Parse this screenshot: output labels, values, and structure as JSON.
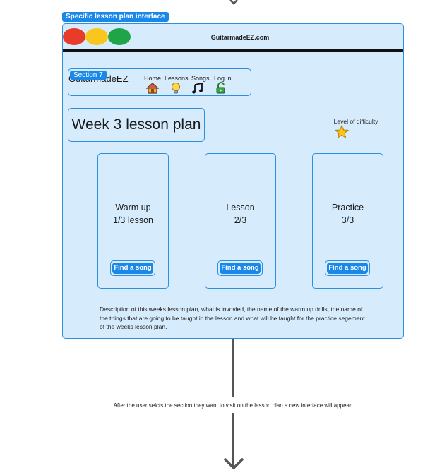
{
  "frame_label": "Specific lesson plan interface",
  "browser": {
    "url": "GuitarmadeEZ.com"
  },
  "site": {
    "name": "GuitarmadeEZ",
    "section_badge": "Section 7",
    "nav": [
      {
        "label": "Home",
        "icon": "house-icon"
      },
      {
        "label": "Lessons",
        "icon": "lightbulb-icon"
      },
      {
        "label": "Songs",
        "icon": "music-note-icon"
      },
      {
        "label": "Log in",
        "icon": "lock-icon"
      }
    ]
  },
  "lesson_plan": {
    "title": "Week 3 lesson plan",
    "difficulty_label": "Level of difficulty",
    "difficulty_stars": 1,
    "cards": [
      {
        "title": "Warm up",
        "progress": "1/3 lesson",
        "button": "Find a song"
      },
      {
        "title": "Lesson",
        "progress": "2/3",
        "button": "Find a song"
      },
      {
        "title": "Practice",
        "progress": "3/3",
        "button": "Find a song"
      }
    ],
    "description": "Description of this weeks lesson plan, what is invovled, the name of the warm up drills, the name of the things that are going to be taught in the lesson and what will be taught for the practice segement of the weeks lesson plan."
  },
  "flow_caption": "After the user selcts the section they want to visit on the lesson plan a new interface will appear.",
  "colors": {
    "accent": "#1a88e8",
    "frame_bg": "#d6ebfc",
    "border": "#2d8fe0",
    "traffic_red": "#e83b2a",
    "traffic_yellow": "#f8c61e",
    "traffic_green": "#1fa548"
  }
}
